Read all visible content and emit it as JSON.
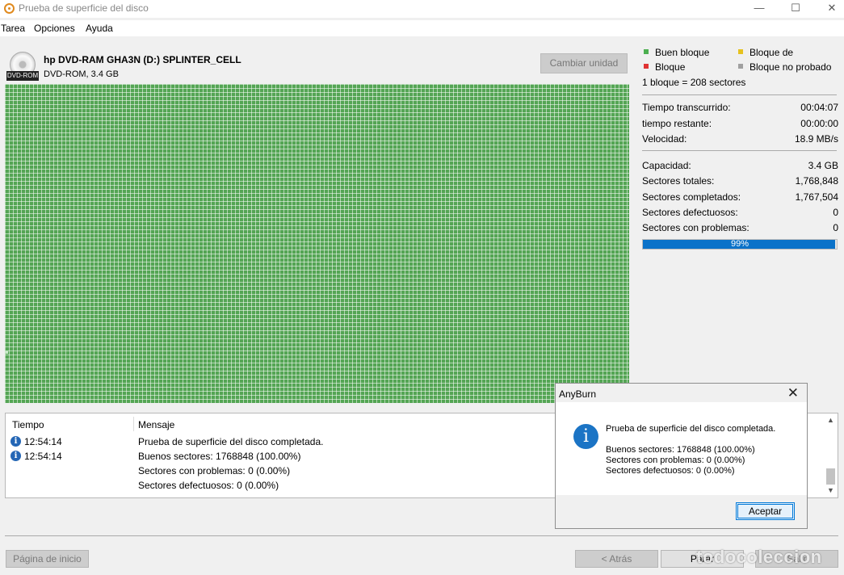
{
  "window": {
    "title": "Prueba de superficie del disco",
    "minimize_icon": "—",
    "maximize_icon": "☐",
    "close_icon": "✕"
  },
  "menu": [
    "Tarea",
    "Opciones",
    "Ayuda"
  ],
  "drive": {
    "icon_label": "DVD-ROM",
    "name": "hp DVD-RAM GHA3N (D:) SPLINTER_CELL",
    "info": "DVD-ROM, 3.4 GB",
    "change_button": "Cambiar unidad"
  },
  "colors": {
    "good_block": "#4caf50",
    "warning_block": "#e6c21e",
    "bad_block": "#e03434",
    "untested_block": "#a0a0a0",
    "progress": "#0a72c9"
  },
  "legend": {
    "good": "Buen bloque",
    "warning": "Bloque de",
    "bad": "Bloque",
    "untested": "Bloque no probado",
    "block_size": "1 bloque = 208 sectores"
  },
  "stats": {
    "elapsed_label": "Tiempo transcurrido:",
    "elapsed": "00:04:07",
    "remaining_label": "tiempo restante:",
    "remaining": "00:00:00",
    "speed_label": "Velocidad:",
    "speed": "18.9 MB/s",
    "capacity_label": "Capacidad:",
    "capacity": "3.4 GB",
    "total_label": "Sectores totales:",
    "total": "1,768,848",
    "completed_label": "Sectores completados:",
    "completed": "1,767,504",
    "defective_label": "Sectores defectuosos:",
    "defective": "0",
    "problem_label": "Sectores con problemas:",
    "problem": "0",
    "progress_text": "99%",
    "progress_fraction": 0.99
  },
  "log": {
    "col_time": "Tiempo",
    "col_message": "Mensaje",
    "times": [
      "12:54:14",
      "12:54:14"
    ],
    "messages": [
      "Prueba de superficie del disco completada.",
      "Buenos sectores:   1768848 (100.00%)",
      "Sectores con problemas:   0 (0.00%)",
      "Sectores defectuosos:   0 (0.00%)"
    ]
  },
  "buttons": {
    "home": "Página de inicio",
    "back": "< Atrás",
    "stop": "Parar",
    "exit": "Salir"
  },
  "dialog": {
    "title": "AnyBurn",
    "close_icon": "✕",
    "icon": "i",
    "heading": "Prueba de superficie del disco completada.",
    "lines": [
      "Buenos sectores:   1768848 (100.00%)",
      "Sectores con problemas:   0 (0.00%)",
      "Sectores defectuosos:   0 (0.00%)"
    ],
    "ok": "Aceptar"
  },
  "watermark": "todocoleccion"
}
